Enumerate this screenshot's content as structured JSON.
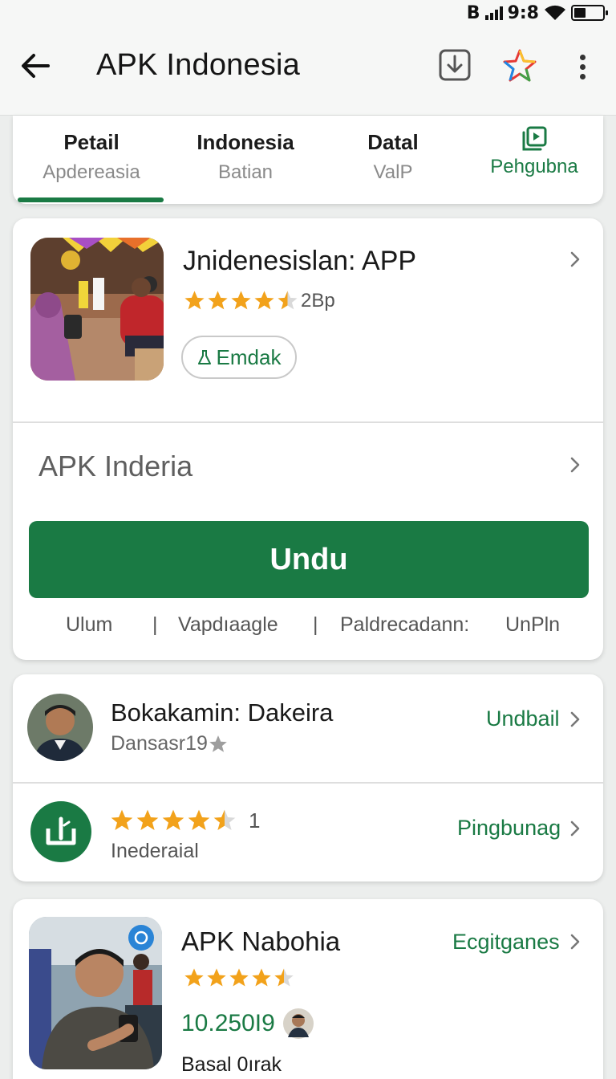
{
  "status_bar": {
    "left_glyph": "B",
    "time": "9:8"
  },
  "app_bar": {
    "title": "APK Indonesia"
  },
  "tabs": [
    {
      "title": "Petail",
      "subtitle": "Apdereasia"
    },
    {
      "title": "Indonesia",
      "subtitle": "Batian"
    },
    {
      "title": "Datal",
      "subtitle": "ValP"
    },
    {
      "title": "",
      "subtitle": "Pehgubna"
    }
  ],
  "app": {
    "name": "Jnidenesislan: APP",
    "rating": 4.5,
    "rating_text": "2Bp",
    "chip_label": "Emdak",
    "subtitle": "APK Inderia",
    "download_label": "Undu",
    "meta": [
      "Ulum",
      "|",
      "Vapdıaagle",
      "|",
      "Paldrecadann:",
      "UnPln"
    ]
  },
  "developer": {
    "name": "Bokakamin: Dakeira",
    "sub": "Dansasr19",
    "link": "Undbail"
  },
  "rating_row": {
    "rating": 4.5,
    "count": "1",
    "label": "Inederaial",
    "link": "Pingbunag"
  },
  "related": {
    "name": "APK Nabohia",
    "rating": 4.5,
    "number": "10.250I9",
    "sub": "Basal 0ırak",
    "link": "Ecgitganes"
  },
  "colors": {
    "accent": "#1a7a44",
    "star": "#f2a21b"
  }
}
